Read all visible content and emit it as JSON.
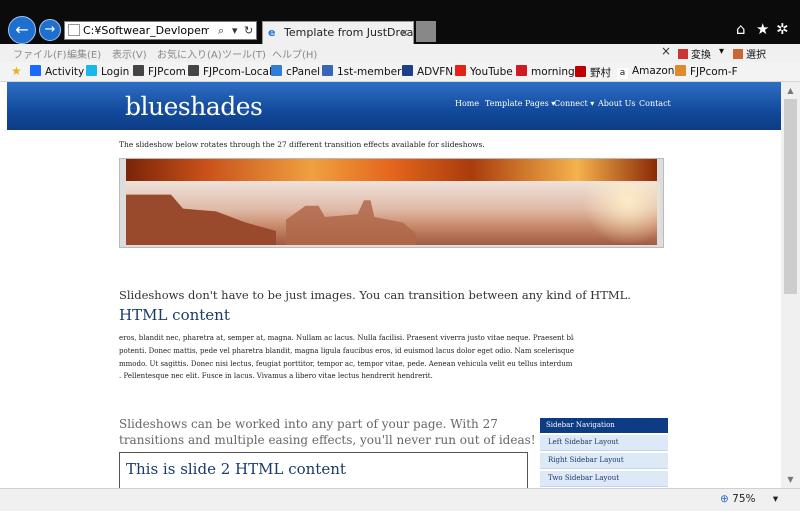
{
  "browser": {
    "address": "C:¥Softwear_Devlopement¥\\",
    "tab_title": "Template from JustDrea…",
    "tab_close": "×",
    "back_glyph": "←",
    "forward_glyph": "→",
    "search_glyph": "⌕",
    "dropdown_glyph": "▾",
    "refresh_glyph": "↻",
    "home_glyph": "⌂",
    "star_glyph": "★",
    "gear_glyph": "✲",
    "zoom": "75%",
    "accent": "#1f6fd1"
  },
  "menu": {
    "items": [
      "ファイル(F)",
      "編集(E)",
      "表示(V)",
      "お気に入り(A)",
      "ツール(T)",
      "ヘルプ(H)"
    ],
    "close": "×",
    "convert": "変換",
    "select": "選択",
    "arrow": "▾"
  },
  "favorites": [
    {
      "label": "Activity",
      "icon": "behance-icon",
      "color": "#1769ff"
    },
    {
      "label": "Login",
      "icon": "vimeo-icon",
      "color": "#1ab7ea"
    },
    {
      "label": "FJPcom",
      "icon": "site-icon",
      "color": "#444444"
    },
    {
      "label": "FJPcom-Local",
      "icon": "site-icon",
      "color": "#444444"
    },
    {
      "label": "cPanel",
      "icon": "ie-page-icon",
      "color": "#2f7fd8"
    },
    {
      "label": "1st-member",
      "icon": "editor-icon",
      "color": "#3a66b8"
    },
    {
      "label": "ADVFN",
      "icon": "bars-icon",
      "color": "#1c3f8c"
    },
    {
      "label": "YouTube",
      "icon": "youtube-icon",
      "color": "#e62117"
    },
    {
      "label": "morning",
      "icon": "m-icon",
      "color": "#d11b24"
    },
    {
      "label": "野村",
      "icon": "nomura-icon",
      "color": "#c00000"
    },
    {
      "label": "Amazon",
      "icon": "amazon-icon",
      "color": "#222222"
    },
    {
      "label": "FJPcom-F",
      "icon": "folder-icon",
      "color": "#e08a2e"
    }
  ],
  "site": {
    "logo": "blueshades",
    "nav": [
      "Home",
      "Template Pages ▾",
      "Connect ▾",
      "About Us",
      "Contact"
    ],
    "intro": "The slideshow below rotates through the 27 different transition effects available for slideshows.",
    "slides_caption": "Slideshows don't have to be just images. You can transition between any kind of HTML.",
    "html_content_title": "HTML content",
    "lorem_lines": [
      "eros, blandit nec, pharetra at, semper at, magna. Nullam ac lacus. Nulla facilisi. Praesent viverra justo vitae neque. Praesent blandit",
      "potenti. Donec mattis, pede vel pharetra blandit, magna ligula faucibus eros, id euismod lacus dolor eget odio. Nam scelerisque. Donec",
      "mmodo. Ut sagittis. Donec nisi lectus, feugiat porttitor, tempor ac, tempor vitae, pede. Aenean vehicula velit eu tellus interdum",
      ". Pellentesque nec elit. Fusce in lacus. Vivamus a libero vitae lectus hendrerit hendrerit."
    ],
    "promo": "Slideshows can be worked into any part of your page. With 27 transitions and multiple easing effects, you'll never run out of ideas!",
    "slide2_title": "This is slide 2 HTML content",
    "sidebar": {
      "title": "Sidebar Navigation",
      "items": [
        "Left Sidebar Layout",
        "Right Sidebar Layout",
        "Two Sidebar Layout"
      ]
    }
  }
}
